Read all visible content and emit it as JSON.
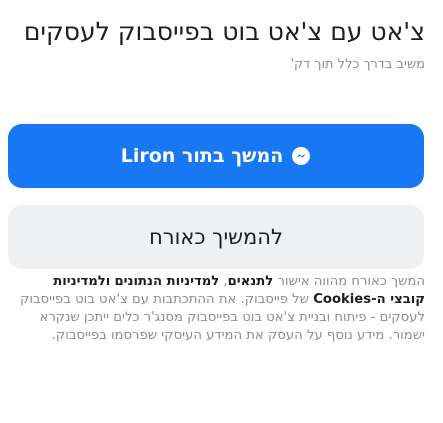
{
  "header": {
    "title": "צ'אט עם צ'אט בוט בפייסבוק לעסקים",
    "subtitle": "משיב בדרך כלל תוך דק'"
  },
  "buttons": {
    "continue_as_user": "המשך בתור Liron",
    "continue_as_guest": "להמשיך כאורח"
  },
  "colors": {
    "primary": "#1877f2",
    "secondary_bg": "#eef0f2",
    "text": "#1c1e21",
    "muted": "#8a8d91"
  },
  "icons": {
    "messenger": "messenger-icon"
  },
  "disclaimer": {
    "part1": "המשך כאורח מהווה אישור ",
    "link_terms": "לתנאים",
    "part2": ", ",
    "link_privacy": "למדיניות הנתונים",
    "part3": " ",
    "link_cookies": "ולמדיניות קובצי ה-Cookies",
    "part4": " של פייסבוק. את ההתכתבות עם צ'אט בוט בפייסבוק לעסקים - פיתוח ובניית צ'אט בוט בפייסבוק מסנג'ר כלים ייתכן שנקרא ישמור. מידע נוסף על העסק את המידע העיסקי שפרסמו בפייסבוק."
  }
}
